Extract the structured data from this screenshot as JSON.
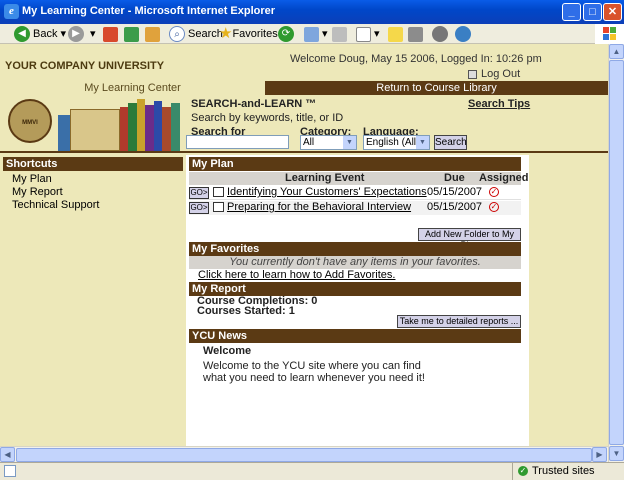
{
  "window": {
    "title": "My Learning Center - Microsoft Internet Explorer",
    "minimize": "_",
    "maximize": "□",
    "close": "✕"
  },
  "toolbar": {
    "back": "Back",
    "search": "Search",
    "favorites": "Favorites"
  },
  "header": {
    "company": "YOUR COMPANY UNIVERSITY",
    "welcome": "Welcome  Doug,  May 15 2006,  Logged In:  10:26 pm",
    "logout": "Log Out"
  },
  "tabs": {
    "my_learning_center": "My Learning Center",
    "return_library": "Return to Course Library"
  },
  "search": {
    "title": "SEARCH-and-LEARN ™",
    "tips": "Search Tips",
    "subtitle": "Search by keywords, title, or ID",
    "search_for_label": "Search for",
    "search_value": "",
    "category_label": "Category:",
    "category_value": "All",
    "language_label": "Language:",
    "language_value": "English (All)",
    "button": "Search",
    "seal_text": "MMVI"
  },
  "sidebar": {
    "title": "Shortcuts",
    "items": [
      "My Plan",
      "My Report",
      "Technical Support"
    ]
  },
  "my_plan": {
    "title": "My Plan",
    "col_event": "Learning Event",
    "col_due": "Due",
    "col_assigned": "Assigned",
    "rows": [
      {
        "go": "GO>",
        "title": "Identifying Your Customers' Expectations",
        "due": "05/15/2007"
      },
      {
        "go": "GO>",
        "title": "Preparing for the Behavioral Interview",
        "due": "05/15/2007"
      }
    ],
    "add_folder": "Add New Folder to My Plan"
  },
  "my_favorites": {
    "title": "My Favorites",
    "empty": "You currently don't have any items in your favorites.",
    "learn_link": "Click here to learn how to Add Favorites."
  },
  "my_report": {
    "title": "My Report",
    "completions": "Course Completions: 0",
    "started": "Courses Started: 1",
    "detailed": "Take me to detailed reports ..."
  },
  "news": {
    "title": "YCU News",
    "heading": "Welcome",
    "line1": "Welcome to the YCU site where you can find",
    "line2": "what you need to learn whenever you need it!"
  },
  "status": {
    "zone": "Trusted sites"
  },
  "colors": {
    "brown": "#5b3a14",
    "cream": "#ede8b9",
    "xp_blue": "#0a5ce8"
  }
}
